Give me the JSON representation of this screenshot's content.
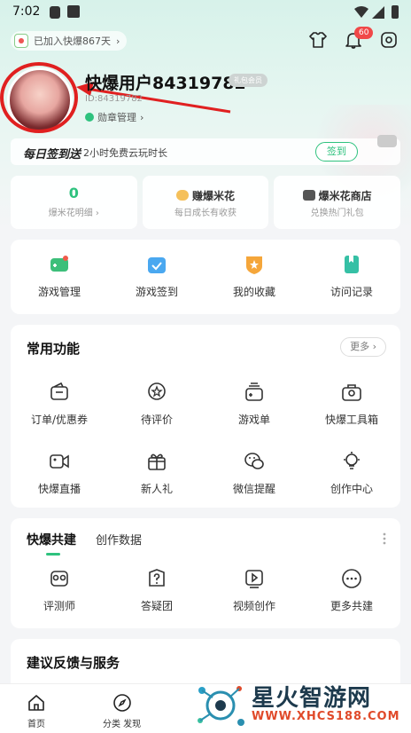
{
  "status_bar": {
    "time": "7:02"
  },
  "header": {
    "join_days_badge": "已加入快爆867天",
    "notification_count": "60"
  },
  "profile": {
    "username": "快爆用户84319782",
    "vip_tag": "礼包会员",
    "uid": "ID:84319782",
    "medal_label": "勋章管理"
  },
  "daily_signin": {
    "title": "每日签到送",
    "text": "2小时免费云玩时长",
    "button": "签到"
  },
  "stats": [
    {
      "value": "0",
      "label": "爆米花明细 ›"
    },
    {
      "title": "赚爆米花",
      "sub": "每日成长有收获"
    },
    {
      "title": "爆米花商店",
      "sub": "兑换热门礼包"
    }
  ],
  "quick_grid": [
    {
      "label": "游戏管理",
      "icon": "gamepad-icon"
    },
    {
      "label": "游戏签到",
      "icon": "calendar-check-icon"
    },
    {
      "label": "我的收藏",
      "icon": "star-shield-icon"
    },
    {
      "label": "访问记录",
      "icon": "bookmark-icon"
    }
  ],
  "common_functions": {
    "title": "常用功能",
    "more": "更多 ›",
    "items": [
      {
        "label": "订单/优惠券",
        "icon": "wallet-icon"
      },
      {
        "label": "待评价",
        "icon": "star-bubble-icon"
      },
      {
        "label": "游戏单",
        "icon": "game-list-icon"
      },
      {
        "label": "快爆工具箱",
        "icon": "toolbox-icon"
      },
      {
        "label": "快爆直播",
        "icon": "video-camera-icon"
      },
      {
        "label": "新人礼",
        "icon": "gift-icon"
      },
      {
        "label": "微信提醒",
        "icon": "wechat-icon"
      },
      {
        "label": "创作中心",
        "icon": "lightbulb-icon"
      }
    ]
  },
  "co_build": {
    "tab_active": "快爆共建",
    "tab_inactive": "创作数据",
    "items": [
      {
        "label": "评测师",
        "icon": "reviewer-icon"
      },
      {
        "label": "答疑团",
        "icon": "question-icon"
      },
      {
        "label": "视频创作",
        "icon": "play-square-icon"
      },
      {
        "label": "更多共建",
        "icon": "more-dots-icon"
      }
    ]
  },
  "feedback": {
    "title": "建议反馈与服务"
  },
  "bottom_nav": [
    {
      "label": "首页",
      "icon": "home-icon"
    },
    {
      "label": "分类 发现",
      "icon": "compass-icon"
    }
  ],
  "watermark": {
    "title": "星火智游网",
    "url": "WWW.XHCS188.COM"
  }
}
